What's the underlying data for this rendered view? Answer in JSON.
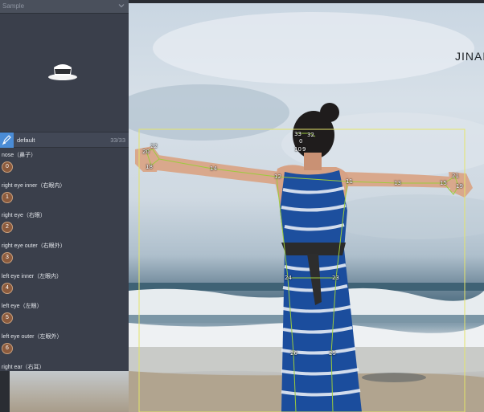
{
  "panel": {
    "title": "Sample",
    "chevron_icon": "chevron-down-icon",
    "preview_icon": "cup-icon",
    "group": {
      "icon": "edit-icon",
      "name": "default",
      "count": "33/33"
    },
    "items": [
      {
        "label": "nose（鼻子）",
        "index": "0"
      },
      {
        "label": "right eye inner（右眼内）",
        "index": "1"
      },
      {
        "label": "right eye（右眼）",
        "index": "2"
      },
      {
        "label": "right eye outer（右眼外）",
        "index": "3"
      },
      {
        "label": "left eye inner（左眼内）",
        "index": "4"
      },
      {
        "label": "left eye（左眼）",
        "index": "5"
      },
      {
        "label": "left eye outer（左眼外）",
        "index": "6"
      },
      {
        "label": "right ear（右耳）",
        "index": ""
      }
    ]
  },
  "canvas": {
    "brand_text": "JINAN",
    "bbox_color": "#e4e46a",
    "skeleton_color": "#9ccc3c",
    "keypoint_labels": [
      "33",
      "32",
      "0",
      "10",
      "9",
      "22",
      "20",
      "18",
      "14",
      "12",
      "11",
      "13",
      "15",
      "21",
      "19",
      "24",
      "23",
      "26",
      "25"
    ]
  }
}
